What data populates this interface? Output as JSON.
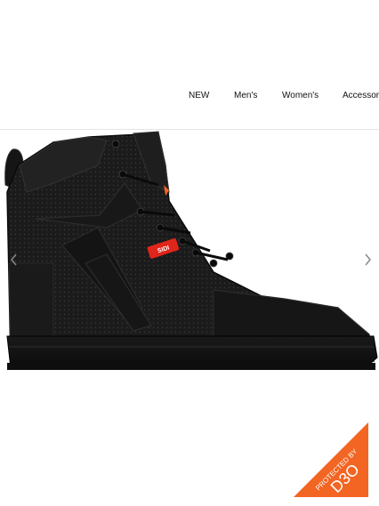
{
  "nav": {
    "items": [
      {
        "label": "NEW"
      },
      {
        "label": "Men's"
      },
      {
        "label": "Women's"
      },
      {
        "label": "Accessor"
      }
    ]
  },
  "product": {
    "tag_text": "SIDI",
    "badge": {
      "line1": "PROTECTED BY",
      "line2": "D3O",
      "color": "#f26522"
    }
  },
  "icons": {
    "prev": "chevron-left-icon",
    "next": "chevron-right-icon"
  },
  "colors": {
    "accent_orange": "#f26522",
    "shoe_black": "#111111",
    "tag_red": "#e0251b"
  }
}
